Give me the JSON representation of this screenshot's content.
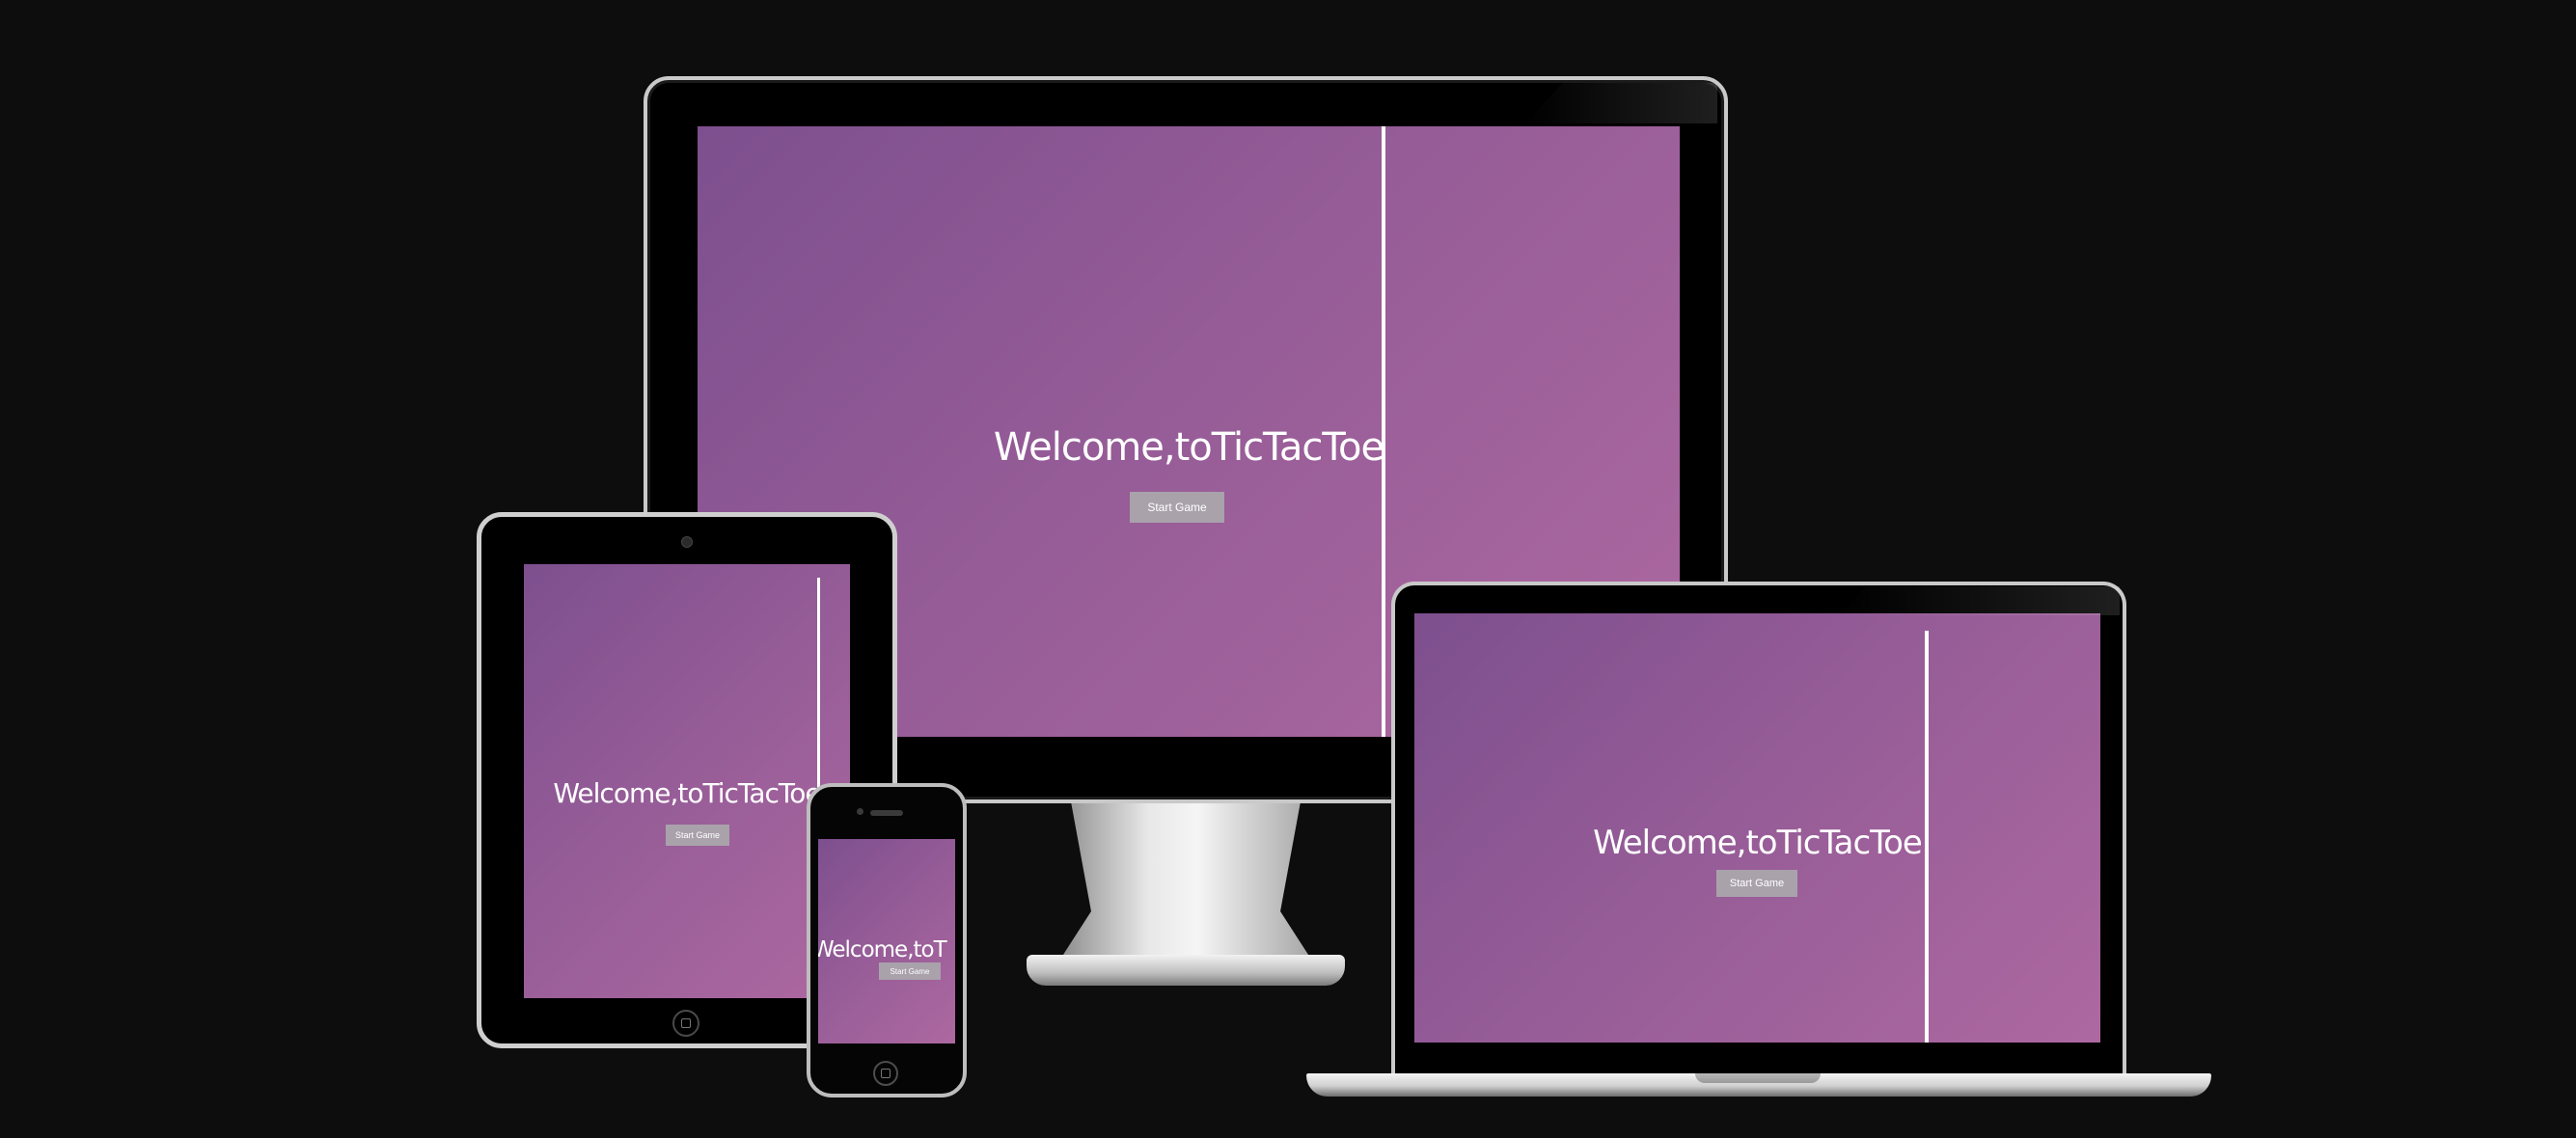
{
  "app": {
    "title": "Welcome,toTicTacToe",
    "start_button_label": "Start Game"
  },
  "devices": {
    "monitor": {
      "title": "Welcome,toTicTacToe",
      "button": "Start Game"
    },
    "tablet": {
      "title": "Welcome,toTicTacToe",
      "button": "Start Game"
    },
    "laptop": {
      "title": "Welcome,toTicTacToe",
      "button": "Start Game"
    },
    "phone": {
      "title": "Welcome,toT",
      "button": "Start Game"
    }
  },
  "colors": {
    "background": "#0e0d0e",
    "gradient_start": "#7d4f8e",
    "gradient_end": "#ad68a0",
    "button": "#a9a2ab",
    "text": "#ffffff"
  }
}
